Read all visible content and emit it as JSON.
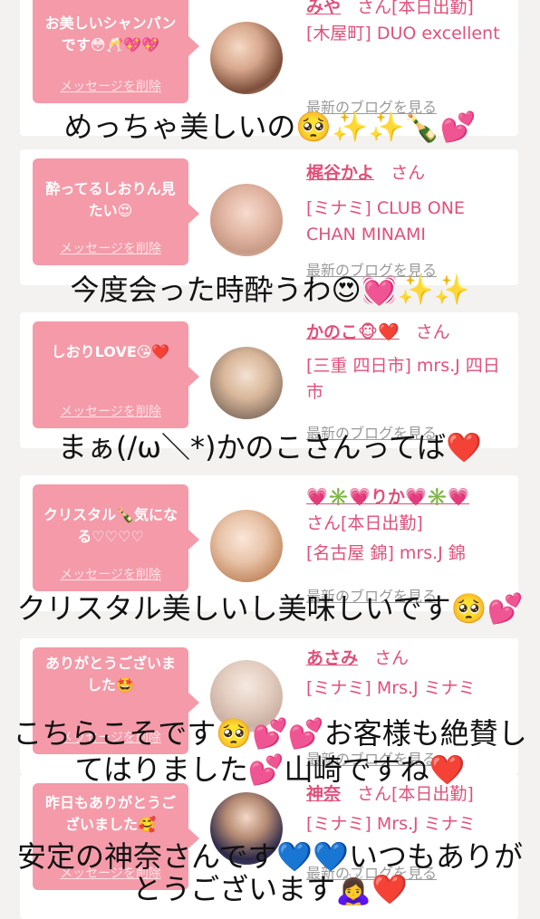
{
  "cards": [
    {
      "bubble": "お美しいシャンパンです😳🥂💖💖",
      "delete": "メッセージを削除",
      "name": "みや",
      "san": "さん[本日出勤]",
      "shop": "[木屋町] DUO excellent",
      "blog": "最新のブログを見る"
    },
    {
      "bubble": "酔ってるしおりん見たい😍",
      "delete": "メッセージを削除",
      "name": "梶谷かよ",
      "san": "さん",
      "shop": "[ミナミ] CLUB ONE CHAN MINAMI",
      "blog": "最新のブログを見る"
    },
    {
      "bubble": "しおりLOVE😘❤️",
      "delete": "メッセージを削除",
      "name": "かのこ🐵❤️",
      "san": "さん",
      "shop": "[三重 四日市] mrs.J 四日市",
      "blog": "最新のブログを見る"
    },
    {
      "bubble": "クリスタル🍾気になる♡♡♡♡",
      "delete": "メッセージを削除",
      "name": "💗✳️💗りか💗✳️💗",
      "san": "さん[本日出勤]",
      "shop": "[名古屋 錦] mrs.J 錦",
      "blog": "最新のブログを見る"
    },
    {
      "bubble": "ありがとうございました🤩",
      "delete": "メッセージを削除",
      "name": "あさみ",
      "san": "さん",
      "shop": "[ミナミ] Mrs.J ミナミ",
      "blog": "最新のブログを見る"
    },
    {
      "bubble": "昨日もありがとうございました🥰",
      "delete": "メッセージを削除",
      "name": "神奈",
      "san": "さん[本日出勤]",
      "shop": "[ミナミ] Mrs.J ミナミ",
      "blog": "最新のブログを見る"
    }
  ],
  "captions": [
    "めっちゃ美しいの🥺✨✨🍾💕",
    "今度会った時酔うわ😍💓✨✨",
    "まぁ(/ω＼*)かのこさんってば❤️",
    "クリスタル美しいし美味しいです🥺💕",
    "こちらこそです🥺💕💕お客様も絶賛し",
    "てはりました💕山崎ですね❤️",
    "安定の神奈さんです💙💙いつもありが",
    "とうございます🙇‍♀️❤️"
  ],
  "colors": {
    "accent": "#e0507a",
    "bubble": "#f49aa9"
  }
}
